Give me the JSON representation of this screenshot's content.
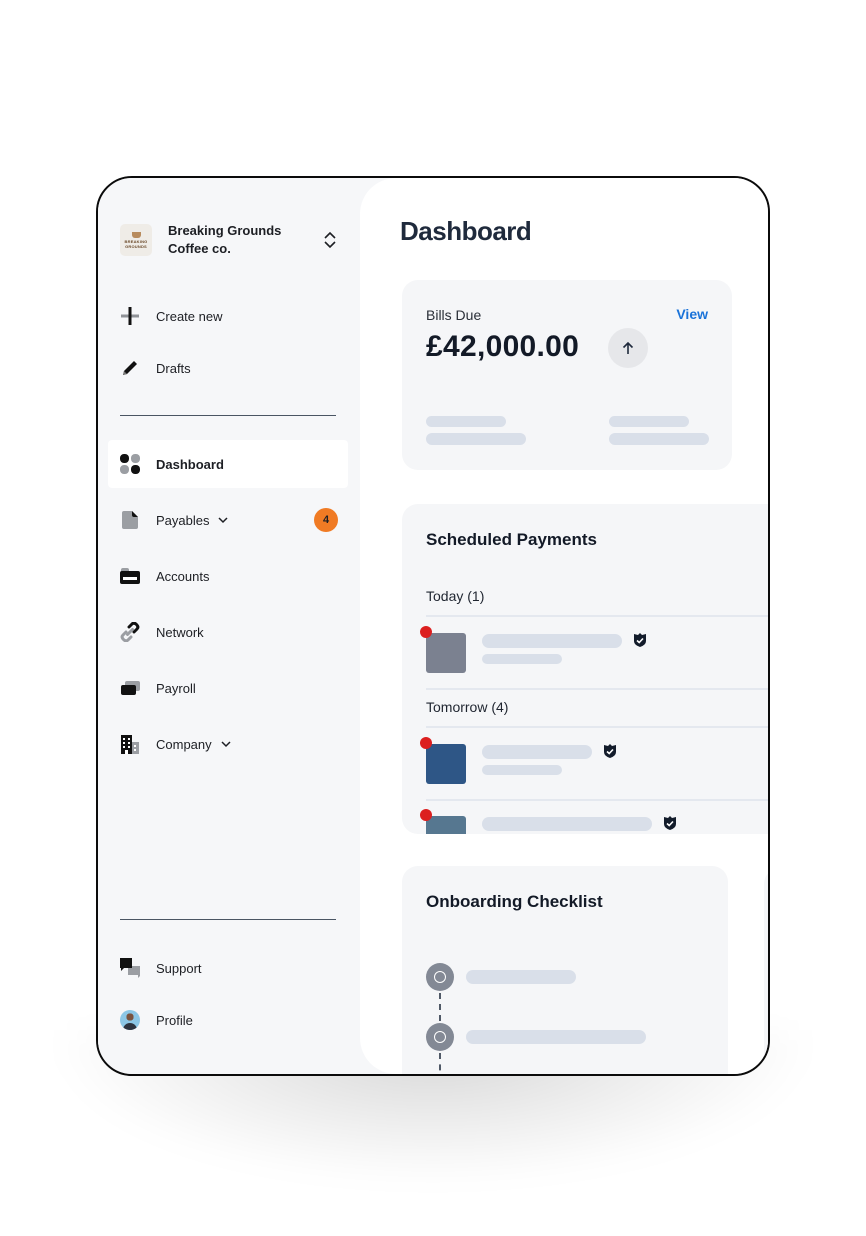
{
  "org": {
    "name": "Breaking Grounds Coffee co.",
    "logo_text_top": "BREAKING",
    "logo_text_bottom": "GROUNDS",
    "switcher_icon": "chevron-up-down-icon"
  },
  "sidebar": {
    "actions": [
      {
        "label": "Create new",
        "icon": "plus-icon"
      },
      {
        "label": "Drafts",
        "icon": "pencil-icon"
      }
    ],
    "items": [
      {
        "label": "Dashboard",
        "icon": "dashboard-grid-icon",
        "active": true
      },
      {
        "label": "Payables",
        "icon": "document-icon",
        "expandable": true,
        "badge": "4"
      },
      {
        "label": "Accounts",
        "icon": "wallet-icon"
      },
      {
        "label": "Network",
        "icon": "link-icon"
      },
      {
        "label": "Payroll",
        "icon": "cards-icon"
      },
      {
        "label": "Company",
        "icon": "building-icon",
        "expandable": true
      }
    ],
    "footer": [
      {
        "label": "Support",
        "icon": "chat-bubbles-icon"
      },
      {
        "label": "Profile",
        "icon": "avatar"
      }
    ]
  },
  "main": {
    "title": "Dashboard",
    "bills_due": {
      "label": "Bills Due",
      "amount": "£42,000.00",
      "view_label": "View",
      "trend_icon": "arrow-up-icon"
    },
    "scheduled_payments": {
      "title": "Scheduled Payments",
      "groups": [
        {
          "label": "Today (1)",
          "items": [
            {
              "color": "#7b8190",
              "verified": true
            }
          ]
        },
        {
          "label": "Tomorrow (4)",
          "items": [
            {
              "color": "#2e5686",
              "verified": true
            },
            {
              "color": "#567790",
              "verified": true
            }
          ]
        }
      ]
    },
    "onboarding": {
      "title": "Onboarding Checklist"
    }
  },
  "colors": {
    "accent_link": "#1a73d9",
    "badge": "#f07b24",
    "alert_dot": "#dc1f1f",
    "skeleton": "#d9dfe9"
  }
}
